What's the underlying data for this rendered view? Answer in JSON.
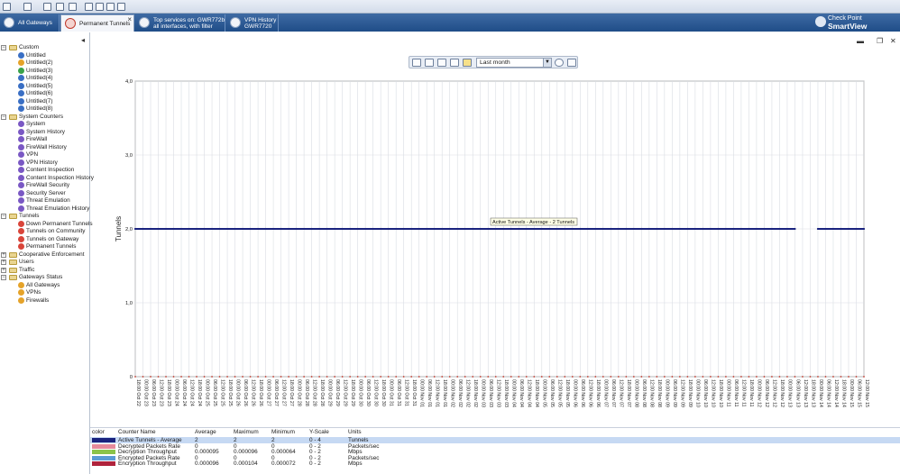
{
  "tabs": [
    {
      "label": "All Gateways",
      "line2": ""
    },
    {
      "label": "Permanent Tunnels",
      "line2": ""
    },
    {
      "label": "Top services on: GWR772b",
      "line2": "all interfaces, with filter"
    },
    {
      "label": "VPN History",
      "line2": "GWR7720"
    }
  ],
  "brand": {
    "line1": "Check Point",
    "line2": "SmartView Monitor"
  },
  "tree": [
    {
      "type": "folder",
      "label": "Custom",
      "exp": "−"
    },
    {
      "type": "leaf",
      "label": "Untitled",
      "color": "#3a6fc4"
    },
    {
      "type": "leaf",
      "label": "Untitled(2)",
      "color": "#e5a32a"
    },
    {
      "type": "leaf",
      "label": "Untitled(3)",
      "color": "#3aa24a"
    },
    {
      "type": "leaf",
      "label": "Untitled(4)",
      "color": "#3a6fc4"
    },
    {
      "type": "leaf",
      "label": "Untitled(5)",
      "color": "#3a6fc4"
    },
    {
      "type": "leaf",
      "label": "Untitled(6)",
      "color": "#3a6fc4"
    },
    {
      "type": "leaf",
      "label": "Untitled(7)",
      "color": "#3a6fc4"
    },
    {
      "type": "leaf",
      "label": "Untitled(8)",
      "color": "#3a6fc4"
    },
    {
      "type": "folder",
      "label": "System Counters",
      "exp": "−"
    },
    {
      "type": "leaf",
      "label": "System",
      "color": "#7a58c4"
    },
    {
      "type": "leaf",
      "label": "System History",
      "color": "#7a58c4"
    },
    {
      "type": "leaf",
      "label": "FireWall",
      "color": "#7a58c4"
    },
    {
      "type": "leaf",
      "label": "FireWall History",
      "color": "#7a58c4"
    },
    {
      "type": "leaf",
      "label": "VPN",
      "color": "#7a58c4"
    },
    {
      "type": "leaf",
      "label": "VPN History",
      "color": "#7a58c4"
    },
    {
      "type": "leaf",
      "label": "Content Inspection",
      "color": "#7a58c4"
    },
    {
      "type": "leaf",
      "label": "Content Inspection History",
      "color": "#7a58c4"
    },
    {
      "type": "leaf",
      "label": "FireWall Security",
      "color": "#7a58c4"
    },
    {
      "type": "leaf",
      "label": "Security Server",
      "color": "#7a58c4"
    },
    {
      "type": "leaf",
      "label": "Threat Emulation",
      "color": "#7a58c4"
    },
    {
      "type": "leaf",
      "label": "Threat Emulation History",
      "color": "#7a58c4"
    },
    {
      "type": "folder",
      "label": "Tunnels",
      "exp": "−"
    },
    {
      "type": "leaf",
      "label": "Down Permanent Tunnels",
      "color": "#d9453a"
    },
    {
      "type": "leaf",
      "label": "Tunnels on Community",
      "color": "#d9453a"
    },
    {
      "type": "leaf",
      "label": "Tunnels on Gateway",
      "color": "#d9453a"
    },
    {
      "type": "leaf",
      "label": "Permanent Tunnels",
      "color": "#d9453a"
    },
    {
      "type": "folder",
      "label": "Cooperative Enforcement",
      "exp": "+"
    },
    {
      "type": "folder",
      "label": "Users",
      "exp": "+"
    },
    {
      "type": "folder",
      "label": "Traffic",
      "exp": "+"
    },
    {
      "type": "folder",
      "label": "Gateways Status",
      "exp": "−"
    },
    {
      "type": "leaf",
      "label": "All Gateways",
      "color": "#e5a32a"
    },
    {
      "type": "leaf",
      "label": "VPNs",
      "color": "#e5a32a"
    },
    {
      "type": "leaf",
      "label": "Firewalls",
      "color": "#e5a32a"
    }
  ],
  "chart_toolbar": {
    "range_value": "Last month"
  },
  "window_controls": {
    "minimize": "▬",
    "restore": "❐",
    "close": "✕"
  },
  "chart_data": {
    "type": "line",
    "ylabel": "Tunnels",
    "ylim": [
      0,
      4
    ],
    "yticks": [
      "0",
      "1,0",
      "2,0",
      "3,0",
      "4,0"
    ],
    "x_tick_labels": [
      "18:00 Oct 22",
      "00:00 Oct 23",
      "06:00 Oct 23",
      "12:00 Oct 23",
      "18:00 Oct 23",
      "00:00 Oct 24",
      "06:00 Oct 24",
      "12:00 Oct 24",
      "18:00 Oct 24",
      "00:00 Oct 25",
      "06:00 Oct 25",
      "12:00 Oct 25",
      "18:00 Oct 25",
      "00:00 Oct 26",
      "06:00 Oct 26",
      "12:00 Oct 26",
      "18:00 Oct 26",
      "00:00 Oct 27",
      "06:00 Oct 27",
      "12:00 Oct 27",
      "18:00 Oct 27",
      "00:00 Oct 28",
      "06:00 Oct 28",
      "12:00 Oct 28",
      "18:00 Oct 28",
      "00:00 Oct 29",
      "06:00 Oct 29",
      "12:00 Oct 29",
      "18:00 Oct 29",
      "00:00 Oct 30",
      "06:00 Oct 30",
      "12:00 Oct 30",
      "18:00 Oct 30",
      "00:00 Oct 31",
      "06:00 Oct 31",
      "12:00 Oct 31",
      "18:00 Oct 31",
      "00:00 Nov 01",
      "06:00 Nov 01",
      "12:00 Nov 01",
      "18:00 Nov 01",
      "00:00 Nov 02",
      "06:00 Nov 02",
      "12:00 Nov 02",
      "18:00 Nov 02",
      "00:00 Nov 03",
      "06:00 Nov 03",
      "12:00 Nov 03",
      "18:00 Nov 03",
      "00:00 Nov 04",
      "06:00 Nov 04",
      "12:00 Nov 04",
      "18:00 Nov 04",
      "00:00 Nov 05",
      "06:00 Nov 05",
      "12:00 Nov 05",
      "18:00 Nov 05",
      "00:00 Nov 06",
      "06:00 Nov 06",
      "12:00 Nov 06",
      "18:00 Nov 06",
      "00:00 Nov 07",
      "06:00 Nov 07",
      "12:00 Nov 07",
      "18:00 Nov 07",
      "00:00 Nov 08",
      "06:00 Nov 08",
      "12:00 Nov 08",
      "18:00 Nov 08",
      "00:00 Nov 09",
      "06:00 Nov 09",
      "12:00 Nov 09",
      "18:00 Nov 09",
      "00:00 Nov 10",
      "06:00 Nov 10",
      "12:00 Nov 10",
      "18:00 Nov 10",
      "00:00 Nov 11",
      "06:00 Nov 11",
      "12:00 Nov 11",
      "18:00 Nov 11",
      "00:00 Nov 12",
      "06:00 Nov 12",
      "12:00 Nov 12",
      "18:00 Nov 12",
      "00:00 Nov 13",
      "06:00 Nov 13",
      "12:00 Nov 13",
      "18:00 Nov 13",
      "00:00 Nov 14",
      "06:00 Nov 14",
      "12:00 Nov 14",
      "18:00 Nov 14",
      "00:00 Nov 15",
      "06:00 Nov 15",
      "12:00 Nov 15"
    ],
    "series": [
      {
        "name": "Active Tunnels - Average",
        "color": "#1a237e",
        "segments": [
          {
            "x_from": "18:00 Oct 22",
            "x_to": "06:00 Nov 13",
            "y": 2
          },
          {
            "x_from": "00:00 Nov 14",
            "x_to": "12:00 Nov 15",
            "y": 2
          }
        ]
      }
    ],
    "annotation": "Active Tunnels - Average - 2 Tunnels"
  },
  "legend_table": {
    "headers": {
      "color": "color",
      "counter": "Counter Name",
      "average": "Average",
      "maximum": "Maximum",
      "minimum": "Minimum",
      "yscale": "Y-Scale",
      "units": "Units"
    },
    "rows": [
      {
        "color": "#1a237e",
        "counter": "Active Tunnels - Average",
        "average": "2",
        "maximum": "2",
        "minimum": "2",
        "yscale": "0 - 4",
        "units": "Tunnels"
      },
      {
        "color": "#e68a9c",
        "counter": "Decrypted Packets Rate",
        "average": "0",
        "maximum": "0",
        "minimum": "0",
        "yscale": "0 - 2",
        "units": "Packets/sec"
      },
      {
        "color": "#8bc34a",
        "counter": "Decryption Throughput",
        "average": "0.000095",
        "maximum": "0.000096",
        "minimum": "0.000064",
        "yscale": "0 - 2",
        "units": "Mbps"
      },
      {
        "color": "#5b9bd5",
        "counter": "Encrypted Packets Rate",
        "average": "0",
        "maximum": "0",
        "minimum": "0",
        "yscale": "0 - 2",
        "units": "Packets/sec"
      },
      {
        "color": "#b0233c",
        "counter": "Encryption Throughput",
        "average": "0.000096",
        "maximum": "0.000104",
        "minimum": "0.000072",
        "yscale": "0 - 2",
        "units": "Mbps"
      }
    ]
  }
}
